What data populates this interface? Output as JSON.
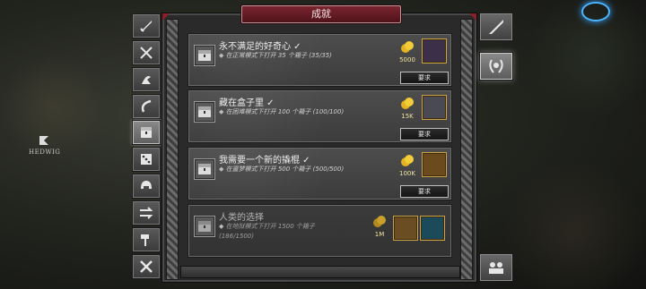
{
  "window": {
    "title": "成就"
  },
  "hero": {
    "name": "HEDWIG"
  },
  "left_tabs": [
    {
      "icon": "sword-icon"
    },
    {
      "icon": "crossed-swords-icon"
    },
    {
      "icon": "skill-icon"
    },
    {
      "icon": "curve-icon"
    },
    {
      "icon": "chest-icon",
      "active": true
    },
    {
      "icon": "dice-icon"
    },
    {
      "icon": "helmet-icon"
    },
    {
      "icon": "arrows-icon"
    },
    {
      "icon": "hammer-icon"
    },
    {
      "icon": "crossed-hammers-icon"
    }
  ],
  "right_tabs": [
    {
      "icon": "sword-icon"
    },
    {
      "icon": "laurel-icon",
      "active": true
    },
    {
      "icon": "group-icon"
    }
  ],
  "achievements": [
    {
      "title": "永不满足的好奇心 ✓",
      "desc": "在正常模式下打开 35 个箱子 (35/35)",
      "gold": "5000",
      "claim": "要求",
      "item_color": "#3b2f4a",
      "locked": false
    },
    {
      "title": "藏在盒子里 ✓",
      "desc": "在困难模式下打开 100 个箱子 (100/100)",
      "gold": "15K",
      "claim": "要求",
      "item_color": "#4a4a55",
      "locked": false
    },
    {
      "title": "我需要一个新的撬棍 ✓",
      "desc": "在噩梦模式下打开 500 个箱子 (500/500)",
      "gold": "100K",
      "claim": "要求",
      "item_color": "#6b4a1e",
      "locked": false
    },
    {
      "title": "人类的选择",
      "desc": "在地狱模式下打开 1500 个箱子 (186/1500)",
      "gold": "1M",
      "item_color": "#6a4d23",
      "item2_color": "#1b4a5a",
      "locked": true
    }
  ],
  "colors": {
    "title_banner": "#7a2530",
    "gold_text": "#f0e4a0",
    "item_border": "#c9a24a"
  }
}
